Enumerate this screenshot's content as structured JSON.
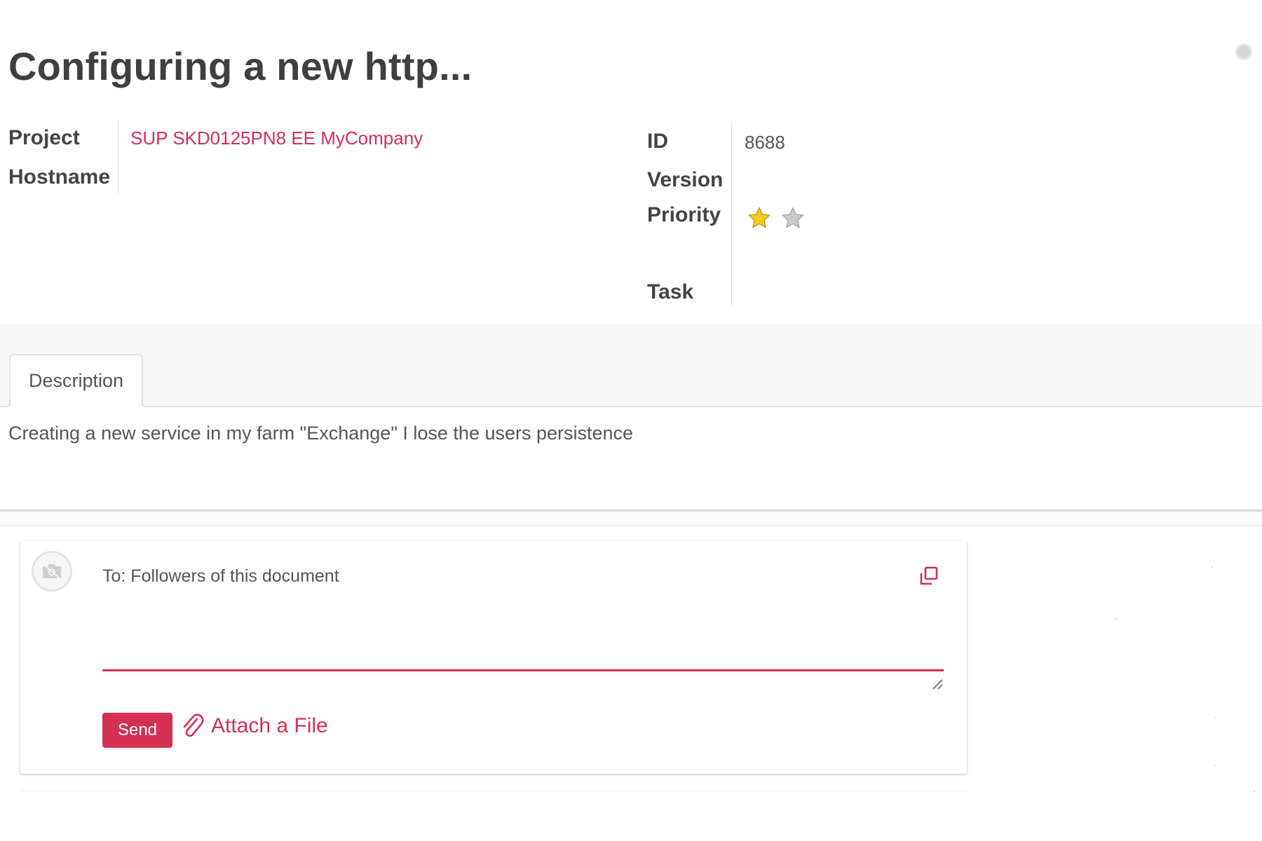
{
  "record": {
    "title": "Configuring a new http..."
  },
  "fields_left": {
    "project_label": "Project",
    "project_value": "SUP SKD0125PN8 EE MyCompany",
    "hostname_label": "Hostname",
    "hostname_value": ""
  },
  "fields_right": {
    "id_label": "ID",
    "id_value": "8688",
    "version_label": "Version",
    "version_value": "",
    "priority_label": "Priority",
    "priority": {
      "filled": 1,
      "total": 2
    },
    "task_label": "Task",
    "task_value": ""
  },
  "tabs": [
    {
      "label": "Description",
      "active": true
    }
  ],
  "description": {
    "text": "Creating a new service in my farm \"Exchange\" I lose the users persistence"
  },
  "composer": {
    "to_line": "To: Followers of this document",
    "message_value": "",
    "send_label": "Send",
    "attach_label": "Attach a File"
  },
  "colors": {
    "accent": "#d52f53",
    "star_filled": "#f3cc23",
    "star_empty": "#c9c9c9"
  },
  "icons": [
    "status-dot-icon",
    "star-icon",
    "avatar-placeholder-icon",
    "expand-icon",
    "resize-grip-icon",
    "paperclip-icon"
  ]
}
